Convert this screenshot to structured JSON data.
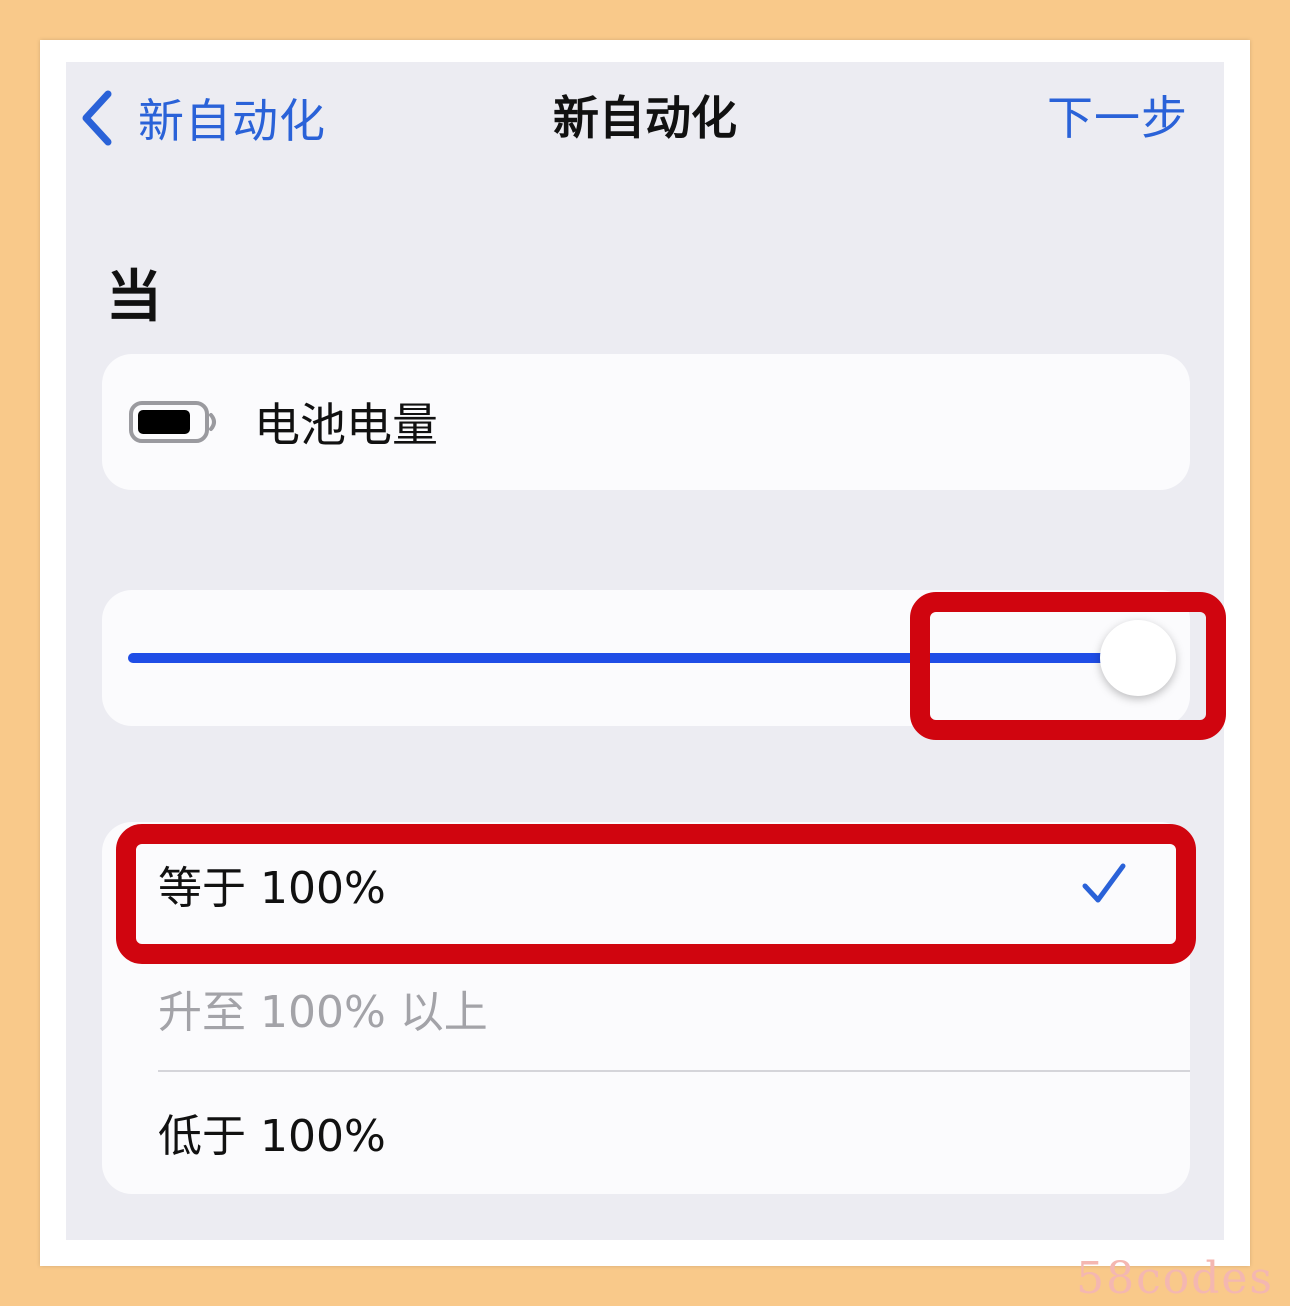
{
  "nav": {
    "back_label": "新自动化",
    "title": "新自动化",
    "next_label": "下一步"
  },
  "section": {
    "header": "当"
  },
  "trigger": {
    "icon": "battery-icon",
    "label": "电池电量"
  },
  "slider": {
    "value_percent": 100
  },
  "options": [
    {
      "label": "等于 100%",
      "selected": true,
      "enabled": true
    },
    {
      "label": "升至 100% 以上",
      "selected": false,
      "enabled": false
    },
    {
      "label": "低于 100%",
      "selected": false,
      "enabled": true
    }
  ],
  "watermark": "58codes",
  "colors": {
    "accent": "#2a62d8",
    "slider_fill": "#1f4de6",
    "highlight": "#d0050f",
    "background": "#ececf2"
  }
}
